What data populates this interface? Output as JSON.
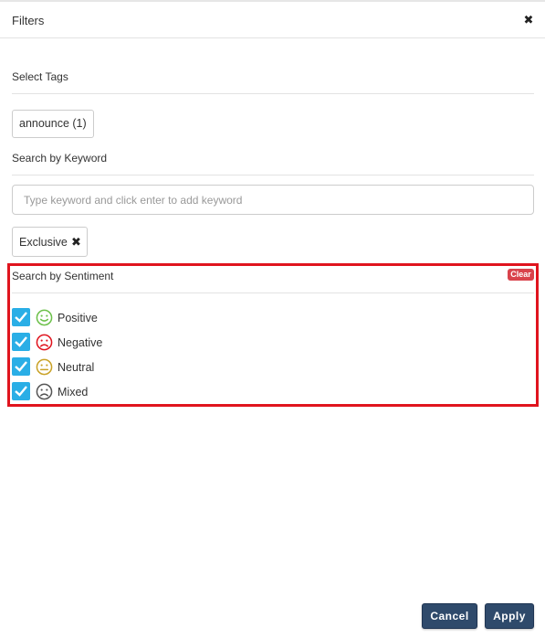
{
  "header": {
    "title": "Filters",
    "close_icon": "close-icon"
  },
  "tags": {
    "label": "Select Tags",
    "chips": [
      "announce (1)"
    ]
  },
  "keyword": {
    "label": "Search by Keyword",
    "input_placeholder": "Type keyword and click enter to add keyword",
    "input_value": "",
    "chips": [
      "Exclusive"
    ]
  },
  "sentiment": {
    "label": "Search by Sentiment",
    "clear_label": "Clear",
    "highlight_color": "#e0141e",
    "items": [
      {
        "label": "Positive",
        "checked": true,
        "icon": "smile-icon",
        "icon_color": "#6cc04a"
      },
      {
        "label": "Negative",
        "checked": true,
        "icon": "frown-icon",
        "icon_color": "#e0141e"
      },
      {
        "label": "Neutral",
        "checked": true,
        "icon": "neutral-face-icon",
        "icon_color": "#c9a227"
      },
      {
        "label": "Mixed",
        "checked": true,
        "icon": "mixed-face-icon",
        "icon_color": "#555555"
      }
    ]
  },
  "footer": {
    "cancel_label": "Cancel",
    "apply_label": "Apply",
    "button_color": "#2f4a6b"
  }
}
